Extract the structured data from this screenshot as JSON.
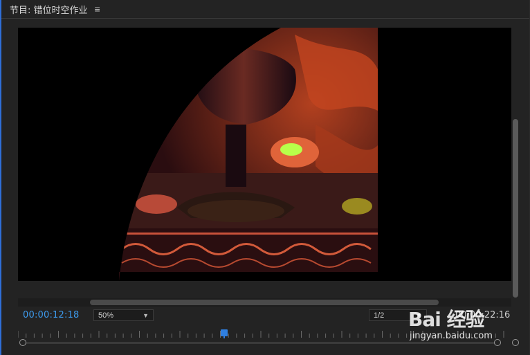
{
  "panel": {
    "title": "节目: 错位时空作业",
    "menu_icon": "≡"
  },
  "viewer": {
    "description_icon": "video-frame"
  },
  "controls": {
    "timecode": "00:00:12:18",
    "zoom": "50%",
    "resolution": "1/2",
    "duration": "00:00:22:16",
    "playhead_fraction": 0.41
  },
  "watermark": {
    "logo": "Bai 经验",
    "url": "jingyan.baidu.com"
  },
  "colors": {
    "accent": "#2f7fe0",
    "timecode": "#3d9cf0",
    "background": "#232323"
  }
}
